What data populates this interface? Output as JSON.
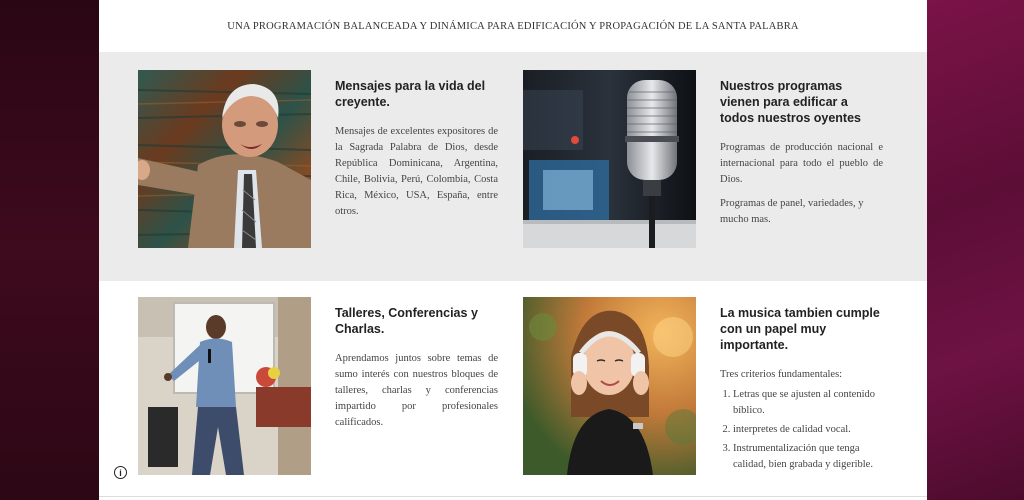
{
  "banner": {
    "text": "UNA PROGRAMACIÓN BALANCEADA Y DINÁMICA PARA EDIFICACIÓN Y PROPAGACIÓN DE LA SANTA PALABRA"
  },
  "cards": [
    {
      "title": "Mensajes para la vida del creyente.",
      "body": "Mensajes de excelentes expositores de la Sagrada Palabra de Dios, desde República Dominicana, Argentina, Chile, Bolivia, Perú, Colombia, Costa Rica, México, USA, España, entre otros."
    },
    {
      "title": "Nuestros programas vienen para edificar a todos nuestros oyentes",
      "body": "Programas de producción nacional e internacional para todo el pueblo de Dios.",
      "body2": "Programas de panel, variedades, y mucho mas."
    },
    {
      "title": "Talleres, Conferencias y Charlas.",
      "body": "Aprendamos juntos sobre temas de sumo interés con nuestros bloques de talleres, charlas y conferencias impartido por profesionales calificados."
    },
    {
      "title": "La musica tambien cumple con un papel muy importante.",
      "intro": "Tres criterios fundamentales:",
      "criteria": [
        "Letras que se ajusten al contenido bíblico.",
        "interpretes de calidad vocal.",
        "Instrumentalización que tenga calidad, bien grabada y digerible."
      ]
    }
  ],
  "icons": {
    "info": "info-icon"
  }
}
